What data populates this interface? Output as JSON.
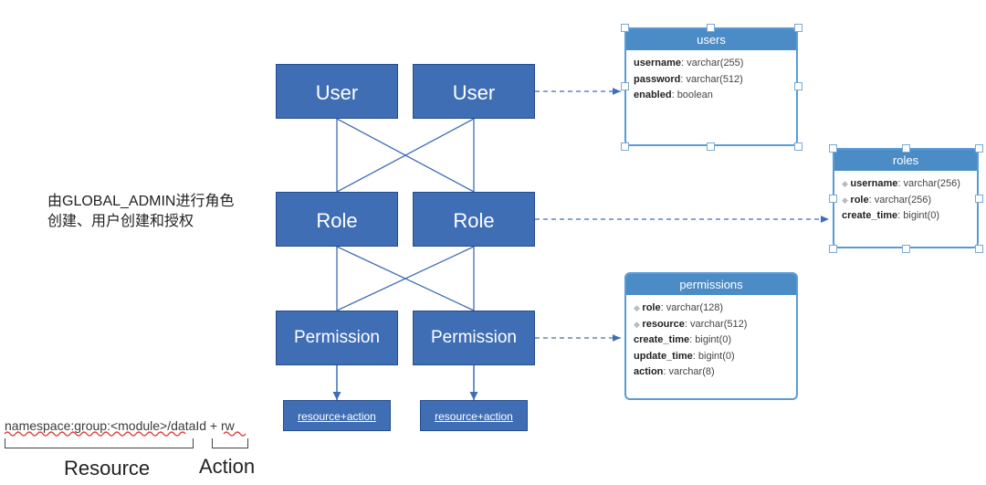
{
  "boxes": {
    "user_left": "User",
    "user_right": "User",
    "role_left": "Role",
    "role_right": "Role",
    "perm_left": "Permission",
    "perm_right": "Permission",
    "res_left": "resource+action",
    "res_right": "resource+action"
  },
  "note": "由GLOBAL_ADMIN进行角色创建、用户创建和授权",
  "legend": {
    "expression": "namespace:group:<module>/dataId + rw",
    "resource": "Resource",
    "action": "Action"
  },
  "tables": {
    "users": {
      "title": "users",
      "rows": [
        {
          "key": false,
          "name": "username",
          "type": "varchar(255)"
        },
        {
          "key": false,
          "name": "password",
          "type": "varchar(512)"
        },
        {
          "key": false,
          "name": "enabled",
          "type": "boolean"
        }
      ]
    },
    "roles": {
      "title": "roles",
      "rows": [
        {
          "key": true,
          "name": "username",
          "type": "varchar(256)"
        },
        {
          "key": true,
          "name": "role",
          "type": "varchar(256)"
        },
        {
          "key": false,
          "name": "create_time",
          "type": "bigint(0)"
        }
      ]
    },
    "permissions": {
      "title": "permissions",
      "rows": [
        {
          "key": true,
          "name": "role",
          "type": "varchar(128)"
        },
        {
          "key": true,
          "name": "resource",
          "type": "varchar(512)"
        },
        {
          "key": false,
          "name": "create_time",
          "type": "bigint(0)"
        },
        {
          "key": false,
          "name": "update_time",
          "type": "bigint(0)"
        },
        {
          "key": false,
          "name": "action",
          "type": "varchar(8)"
        }
      ]
    }
  },
  "chart_data": {
    "type": "diagram",
    "entities": [
      "User",
      "Role",
      "Permission",
      "resource+action"
    ],
    "relations": [
      {
        "from": "User",
        "to": "Role",
        "multiplicity": "many-to-many"
      },
      {
        "from": "Role",
        "to": "Permission",
        "multiplicity": "many-to-many"
      },
      {
        "from": "Permission",
        "to": "resource+action",
        "multiplicity": "one-to-one",
        "bidirectional": true
      }
    ],
    "tables": {
      "users": [
        [
          "username",
          "varchar(255)"
        ],
        [
          "password",
          "varchar(512)"
        ],
        [
          "enabled",
          "boolean"
        ]
      ],
      "roles": [
        [
          "username",
          "varchar(256)",
          "PK"
        ],
        [
          "role",
          "varchar(256)",
          "PK"
        ],
        [
          "create_time",
          "bigint(0)"
        ]
      ],
      "permissions": [
        [
          "role",
          "varchar(128)",
          "PK"
        ],
        [
          "resource",
          "varchar(512)",
          "PK"
        ],
        [
          "create_time",
          "bigint(0)"
        ],
        [
          "update_time",
          "bigint(0)"
        ],
        [
          "action",
          "varchar(8)"
        ]
      ]
    },
    "mapping": [
      {
        "entity": "User",
        "table": "users"
      },
      {
        "entity": "Role",
        "table": "roles"
      },
      {
        "entity": "Permission",
        "table": "permissions"
      }
    ],
    "resource_format": "namespace:group:<module>/dataId + rw",
    "note": "由GLOBAL_ADMIN进行角色创建、用户创建和授权"
  }
}
